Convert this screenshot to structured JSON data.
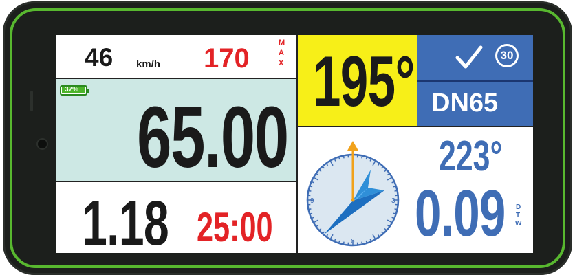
{
  "speed": {
    "value": "46",
    "unit": "km/h"
  },
  "max_speed": {
    "value": "170",
    "label_letters": [
      "M",
      "A",
      "X"
    ]
  },
  "battery": {
    "level": "37%",
    "fill_fraction": 0.37
  },
  "odometer": {
    "value": "65.00"
  },
  "trip": {
    "value": "1.18",
    "timer": "25:00"
  },
  "heading": {
    "value": "195°"
  },
  "limit": {
    "value": "30",
    "status": "check-icon"
  },
  "road": {
    "name": "DN65"
  },
  "compass": {
    "ticks": [
      "3",
      "6",
      "9"
    ],
    "needle_bearing_deg": 0,
    "arrow_bearing_deg": 223
  },
  "waypoint": {
    "bearing": "223°",
    "distance": "0.09",
    "dtw_letters": [
      "D",
      "T",
      "W"
    ]
  },
  "colors": {
    "frame_green": "#58b82f",
    "yellow": "#f7ef18",
    "blue": "#3f6db5",
    "red": "#e32326",
    "mint": "#cde8e4",
    "dark_text": "#222222"
  }
}
